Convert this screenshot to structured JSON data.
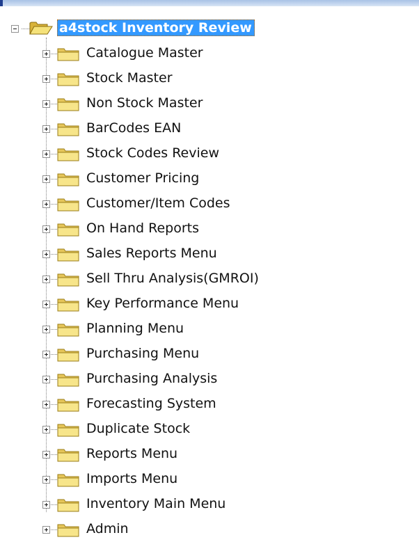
{
  "window": {
    "accent_color": "#3399ff"
  },
  "tree": {
    "root": {
      "label": "a4stock Inventory Review",
      "expanded": true,
      "selected": true,
      "icon": "folder-open-icon"
    },
    "items": [
      {
        "label": "Catalogue Master",
        "icon": "folder-icon",
        "expanded": false
      },
      {
        "label": "Stock Master",
        "icon": "folder-icon",
        "expanded": false
      },
      {
        "label": "Non Stock Master",
        "icon": "folder-icon",
        "expanded": false
      },
      {
        "label": "BarCodes EAN",
        "icon": "folder-icon",
        "expanded": false
      },
      {
        "label": "Stock Codes Review",
        "icon": "folder-icon",
        "expanded": false
      },
      {
        "label": "Customer Pricing",
        "icon": "folder-icon",
        "expanded": false
      },
      {
        "label": "Customer/Item Codes",
        "icon": "folder-icon",
        "expanded": false
      },
      {
        "label": "On Hand Reports",
        "icon": "folder-icon",
        "expanded": false
      },
      {
        "label": "Sales Reports Menu",
        "icon": "folder-icon",
        "expanded": false
      },
      {
        "label": "Sell Thru Analysis(GMROI)",
        "icon": "folder-icon",
        "expanded": false
      },
      {
        "label": "Key Performance Menu",
        "icon": "folder-icon",
        "expanded": false
      },
      {
        "label": "Planning Menu",
        "icon": "folder-icon",
        "expanded": false
      },
      {
        "label": "Purchasing Menu",
        "icon": "folder-icon",
        "expanded": false
      },
      {
        "label": "Purchasing Analysis",
        "icon": "folder-icon",
        "expanded": false
      },
      {
        "label": "Forecasting System",
        "icon": "folder-icon",
        "expanded": false
      },
      {
        "label": "Duplicate Stock",
        "icon": "folder-icon",
        "expanded": false
      },
      {
        "label": "Reports Menu",
        "icon": "folder-icon",
        "expanded": false
      },
      {
        "label": "Imports Menu",
        "icon": "folder-icon",
        "expanded": false
      },
      {
        "label": "Inventory Main Menu",
        "icon": "folder-icon",
        "expanded": false
      },
      {
        "label": "Admin",
        "icon": "folder-icon",
        "expanded": false
      }
    ]
  }
}
